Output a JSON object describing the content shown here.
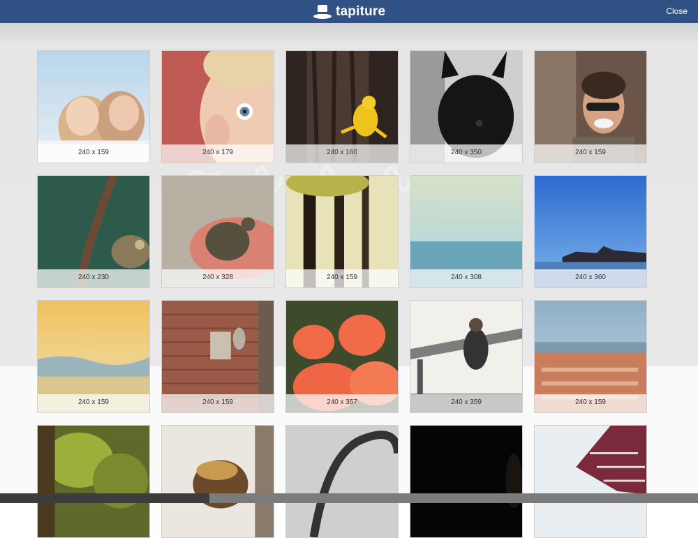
{
  "header": {
    "brand_name": "tapiture",
    "logo_icon": "top-hat-icon",
    "close_label": "Close",
    "bar_color": "#2f5184"
  },
  "images": [
    {
      "caption": "240 x 159",
      "subject": "two-women-smiling"
    },
    {
      "caption": "240 x 179",
      "subject": "child-face"
    },
    {
      "caption": "240 x 160",
      "subject": "yellow-frog-on-tree"
    },
    {
      "caption": "240 x 350",
      "subject": "black-scottish-terrier"
    },
    {
      "caption": "240 x 159",
      "subject": "man-with-sunglasses"
    },
    {
      "caption": "240 x 230",
      "subject": "chameleon-on-branch"
    },
    {
      "caption": "240 x 328",
      "subject": "baby-turtle-in-hand"
    },
    {
      "caption": "240 x 159",
      "subject": "forest-trees"
    },
    {
      "caption": "240 x 308",
      "subject": "beach-horizon"
    },
    {
      "caption": "240 x 360",
      "subject": "blue-sky-rocks"
    },
    {
      "caption": "240 x 159",
      "subject": "sunset-clouds"
    },
    {
      "caption": "240 x 159",
      "subject": "brick-wall-window"
    },
    {
      "caption": "240 x 357",
      "subject": "flamingos"
    },
    {
      "caption": "240 x 359",
      "subject": "man-on-bridge"
    },
    {
      "caption": "240 x 159",
      "subject": "city-rooftops"
    },
    {
      "caption": "",
      "subject": "green-foliage"
    },
    {
      "caption": "",
      "subject": "hawk-bird"
    },
    {
      "caption": "",
      "subject": "metal-arch"
    },
    {
      "caption": "",
      "subject": "dark-portrait"
    },
    {
      "caption": "",
      "subject": "plaid-shirt"
    }
  ]
}
